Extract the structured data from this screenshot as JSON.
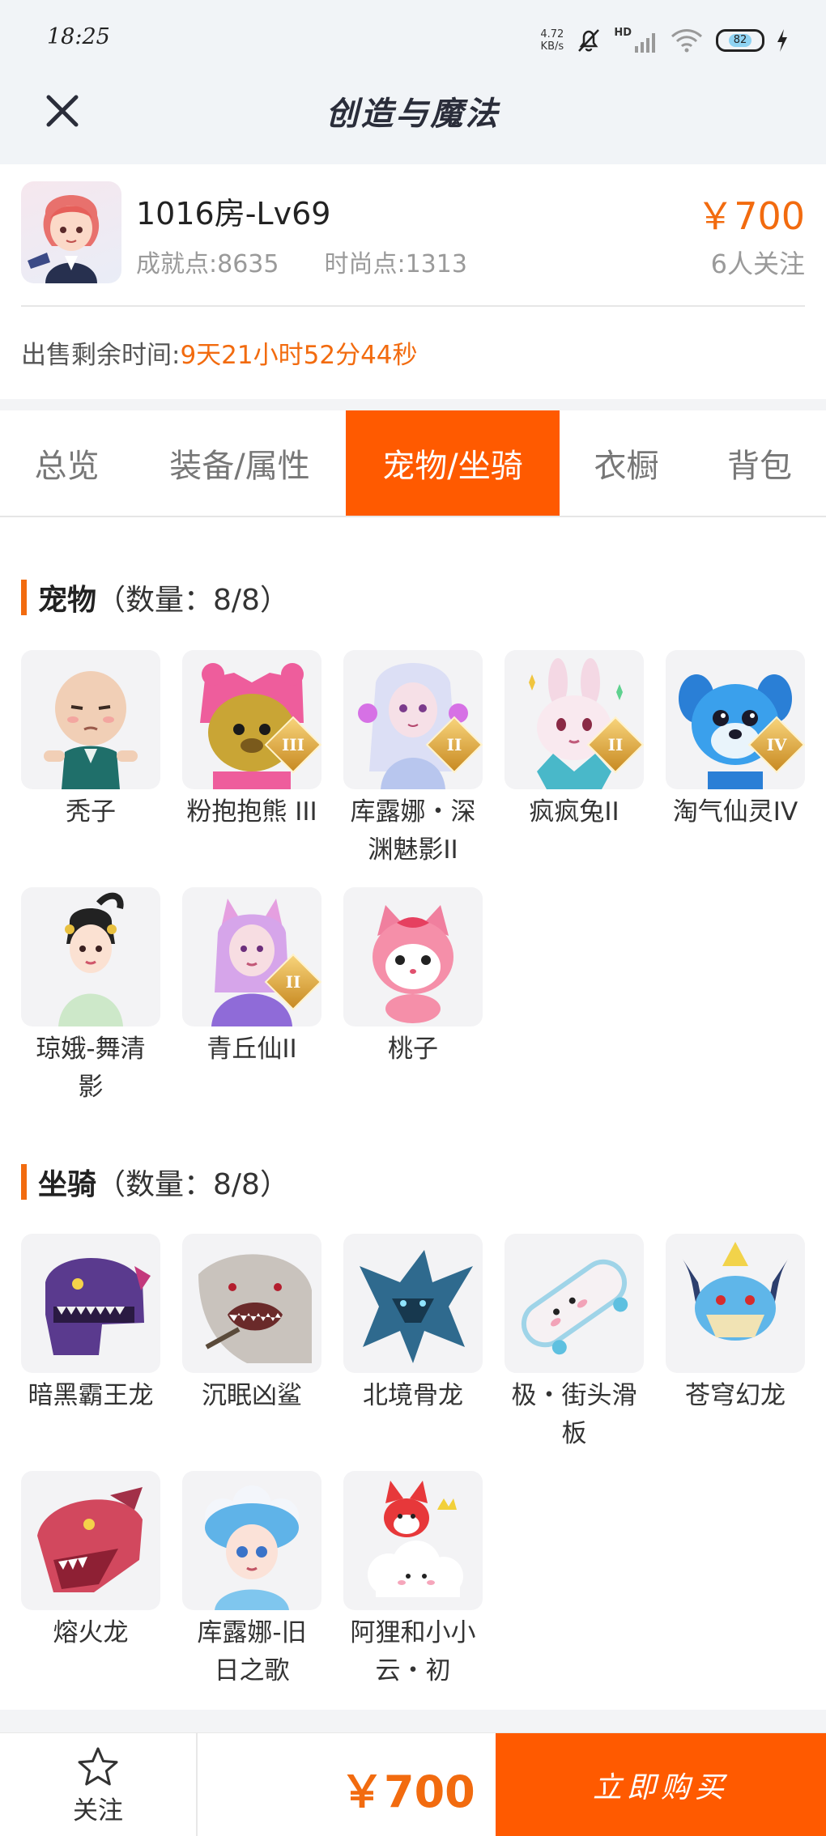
{
  "status_bar": {
    "time": "18:25",
    "net_speed_value": "4.72",
    "net_speed_unit": "KB/s",
    "signal_label": "HD",
    "battery": "82"
  },
  "header": {
    "title": "创造与魔法"
  },
  "account": {
    "name": "1016房-Lv69",
    "achievement": "成就点:8635",
    "fashion": "时尚点:1313",
    "price": "￥700",
    "followers": "6人关注",
    "remaining_label": "出售剩余时间:",
    "remaining_value": "9天21小时52分44秒"
  },
  "tabs": [
    {
      "label": "总览",
      "active": false
    },
    {
      "label": "装备/属性",
      "active": false
    },
    {
      "label": "宠物/坐骑",
      "active": true
    },
    {
      "label": "衣橱",
      "active": false
    },
    {
      "label": "背包",
      "active": false
    }
  ],
  "pets": {
    "title": "宠物",
    "count": "（数量：8/8）",
    "items": [
      {
        "line1": "秃子",
        "line2": "",
        "tier": "",
        "icon": "bald-boy-pet-icon"
      },
      {
        "line1": "粉抱抱熊 III",
        "line2": "",
        "tier": "III",
        "icon": "pink-bear-pet-icon"
      },
      {
        "line1": "库露娜・深",
        "line2": "渊魅影II",
        "tier": "II",
        "icon": "kuluna-pet-icon"
      },
      {
        "line1": "疯疯兔II",
        "line2": "",
        "tier": "II",
        "icon": "crazy-rabbit-pet-icon"
      },
      {
        "line1": "淘气仙灵IV",
        "line2": "",
        "tier": "IV",
        "icon": "naughty-spirit-pet-icon"
      },
      {
        "line1": "琼娥-舞清",
        "line2": "影",
        "tier": "",
        "icon": "qiong-e-pet-icon"
      },
      {
        "line1": "青丘仙II",
        "line2": "",
        "tier": "II",
        "icon": "fox-fairy-pet-icon"
      },
      {
        "line1": "桃子",
        "line2": "",
        "tier": "",
        "icon": "peach-cat-pet-icon"
      }
    ]
  },
  "mounts": {
    "title": "坐骑",
    "count": "（数量：8/8）",
    "items": [
      {
        "line1": "暗黑霸王龙",
        "line2": "",
        "icon": "dark-trex-mount-icon"
      },
      {
        "line1": "沉眠凶鲨",
        "line2": "",
        "icon": "shark-mount-icon"
      },
      {
        "line1": "北境骨龙",
        "line2": "",
        "icon": "bone-dragon-mount-icon"
      },
      {
        "line1": "极・街头滑",
        "line2": "板",
        "icon": "skateboard-mount-icon"
      },
      {
        "line1": "苍穹幻龙",
        "line2": "",
        "icon": "sky-dragon-mount-icon"
      },
      {
        "line1": "熔火龙",
        "line2": "",
        "icon": "lava-dragon-mount-icon"
      },
      {
        "line1": "库露娜-旧",
        "line2": "日之歌",
        "icon": "kuluna-song-mount-icon"
      },
      {
        "line1": "阿狸和小小",
        "line2": "云・初",
        "icon": "ali-cloud-mount-icon"
      }
    ]
  },
  "bottom": {
    "follow": "关注",
    "price": "￥700",
    "buy": "立即购买"
  },
  "colors": {
    "accent": "#ff5a00",
    "price": "#f26b0f"
  }
}
